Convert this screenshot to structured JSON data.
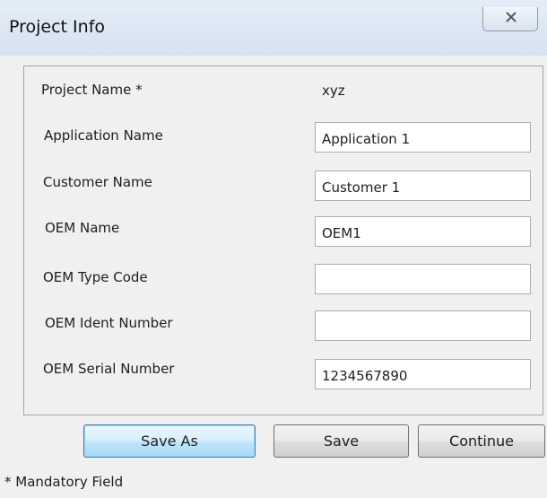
{
  "window": {
    "title": "Project Info",
    "close_icon": "close-icon"
  },
  "fields": [
    {
      "label": "Project Name *",
      "value": "xyz",
      "readonly": true
    },
    {
      "label": "Application Name",
      "value": "Application 1"
    },
    {
      "label": "Customer Name",
      "value": "Customer 1"
    },
    {
      "label": "OEM Name",
      "value": "OEM1"
    },
    {
      "label": "OEM Type Code",
      "value": ""
    },
    {
      "label": "OEM Ident Number",
      "value": ""
    },
    {
      "label": "OEM Serial Number",
      "value": "1234567890"
    }
  ],
  "buttons": {
    "save_as": "Save As",
    "save": "Save",
    "continue": "Continue"
  },
  "footer": {
    "mandatory_note": "* Mandatory Field"
  },
  "colors": {
    "titlebar": "#dae5f2",
    "default_button_border": "#3c7fb1"
  }
}
